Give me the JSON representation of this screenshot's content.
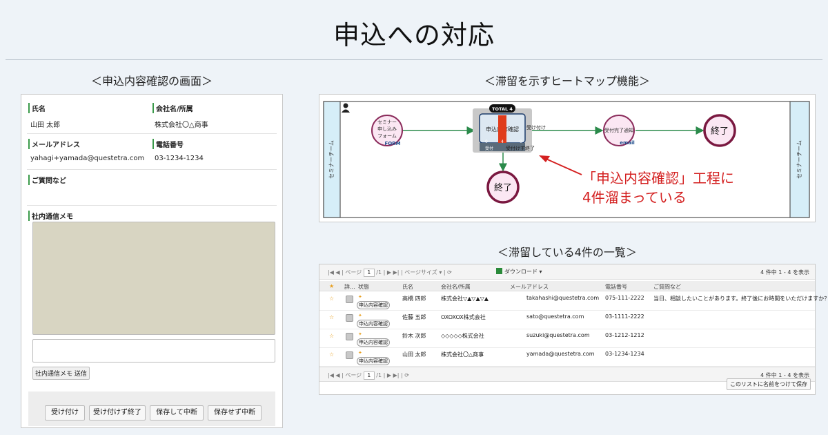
{
  "page_title": "申込への対応",
  "captions": {
    "form": "＜申込内容確認の画面＞",
    "heatmap": "＜滞留を示すヒートマップ機能＞",
    "list": "＜滞留している4件の一覧＞"
  },
  "form": {
    "fields": [
      {
        "label": "氏名",
        "value": "山田 太郎"
      },
      {
        "label": "会社名/所属",
        "value": "株式会社〇△商事"
      },
      {
        "label": "メールアドレス",
        "value": "yahagi+yamada@questetra.com"
      },
      {
        "label": "電話番号",
        "value": "03-1234-1234"
      },
      {
        "label": "ご質問など",
        "value": ""
      },
      {
        "label": "社内通信メモ",
        "value": ""
      }
    ],
    "send_button": "社内通信メモ 送信",
    "buttons": [
      "受け付け",
      "受け付けず終了",
      "保存して中断",
      "保存せず中断"
    ]
  },
  "diagram": {
    "lane_label": "セミナーチーム",
    "start_label_lines": [
      "セミナー",
      "申し込み",
      "フォーム"
    ],
    "start_tag": "FORM",
    "task_label": "申込内容確認",
    "total_badge": "TOTAL 4",
    "stat_labels": [
      "受付",
      "受付けず終了"
    ],
    "stat_values": [
      "0",
      "4",
      "0"
    ],
    "edge_accept": "受け付け",
    "edge_reject": "受付けず終了",
    "mail_label": "受付完了通知",
    "mail_tag": "email",
    "end_label": "終了",
    "heat_level": 1.0,
    "colors": {
      "flow": "#2a8a4a",
      "heat": "#e03c1c",
      "end": "#7a1840",
      "lane": "#d6eef8"
    }
  },
  "callout": {
    "line1": "「申込内容確認」工程に",
    "line2": "4件溜まっている",
    "color": "#d42020"
  },
  "list": {
    "pager": {
      "page_label": "ページ",
      "page_value": "1",
      "page_total": "/1",
      "page_size": "ページサイズ ▾",
      "download": "ダウンロード ▾",
      "count": "4 件中 1 - 4 を表示"
    },
    "columns": [
      "★",
      "詳...",
      "状態",
      "氏名",
      "会社名/所属",
      "メールアドレス",
      "電話番号",
      "ご質問など"
    ],
    "rows": [
      {
        "state": "申込内容確認",
        "name": "高橋 四郎",
        "company": "株式会社▽▲▽▲▽▲",
        "email": "takahashi@questetra.com",
        "phone": "075-111-2222",
        "question": "当日、相談したいことがあります。終了後にお時間をいただけますか？"
      },
      {
        "state": "申込内容確認",
        "name": "佐藤 五郎",
        "company": "OXOXOX株式会社",
        "email": "sato@questetra.com",
        "phone": "03-1111-2222",
        "question": ""
      },
      {
        "state": "申込内容確認",
        "name": "鈴木 次郎",
        "company": "◇◇◇◇◇株式会社",
        "email": "suzuki@questetra.com",
        "phone": "03-1212-1212",
        "question": ""
      },
      {
        "state": "申込内容確認",
        "name": "山田 太郎",
        "company": "株式会社〇△商事",
        "email": "yamada@questetra.com",
        "phone": "03-1234-1234",
        "question": ""
      }
    ],
    "save_name_button": "このリストに名前をつけて保存"
  }
}
